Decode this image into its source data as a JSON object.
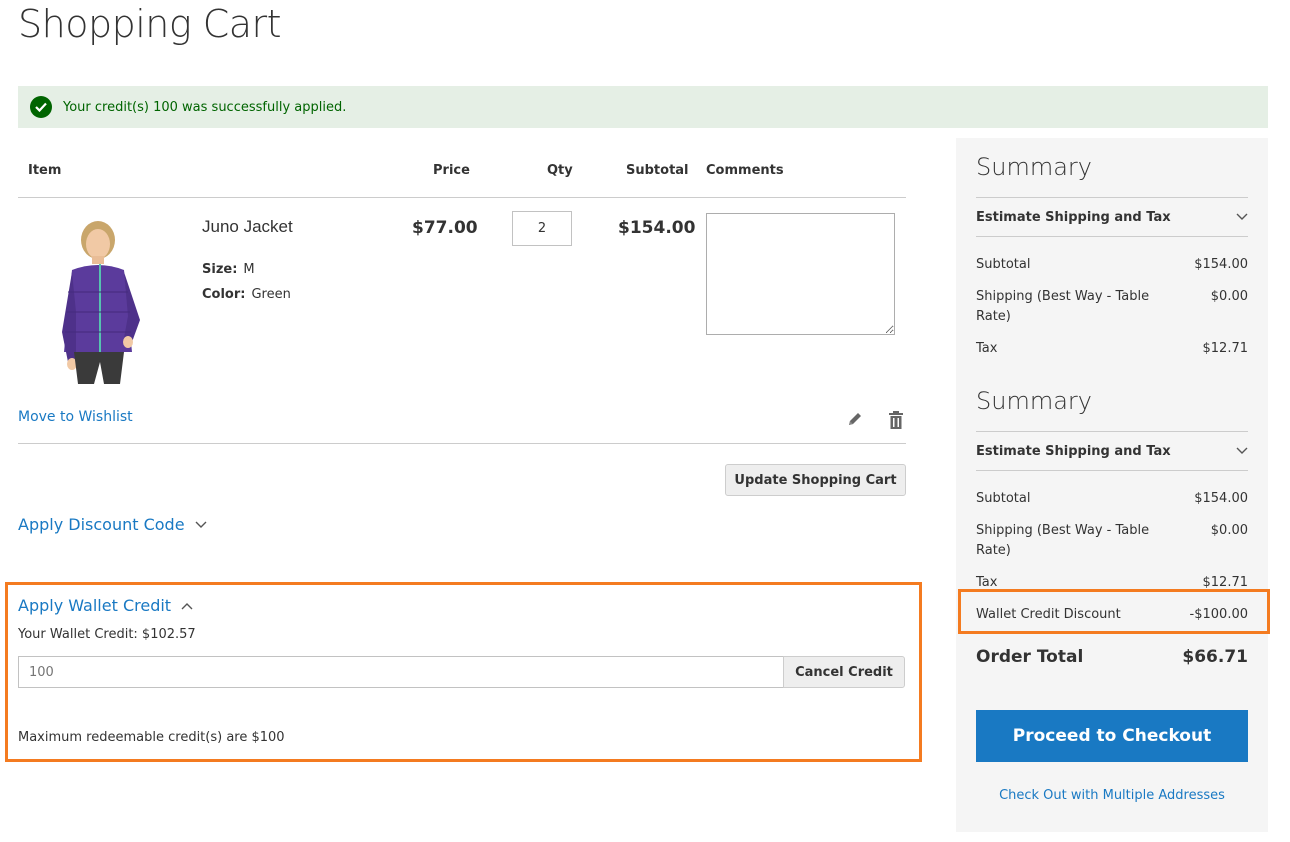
{
  "page": {
    "title": "Shopping Cart"
  },
  "message": {
    "text": "Your credit(s) 100 was successfully applied."
  },
  "cart": {
    "headers": {
      "item": "Item",
      "price": "Price",
      "qty": "Qty",
      "subtotal": "Subtotal",
      "comments": "Comments"
    },
    "item": {
      "name": "Juno Jacket",
      "size_label": "Size:",
      "size_value": "M",
      "color_label": "Color:",
      "color_value": "Green",
      "price": "$77.00",
      "qty": "2",
      "subtotal": "$154.00",
      "comment": ""
    },
    "move_to_wishlist": "Move to Wishlist",
    "update_button": "Update Shopping Cart"
  },
  "discount": {
    "title": "Apply Discount Code"
  },
  "wallet": {
    "title": "Apply Wallet Credit",
    "balance_text": "Your Wallet Credit: $102.57",
    "input_placeholder": "100",
    "cancel_button": "Cancel Credit",
    "max_note": "Maximum redeemable credit(s) are $100"
  },
  "summary": {
    "title": "Summary",
    "estimate_label": "Estimate Shipping and Tax",
    "subtotal_label": "Subtotal",
    "subtotal_value": "$154.00",
    "shipping_label": "Shipping (Best Way - Table Rate)",
    "shipping_value": "$0.00",
    "tax_label": "Tax",
    "tax_value": "$12.71",
    "wallet_discount_label": "Wallet Credit Discount",
    "wallet_discount_value": "-$100.00",
    "order_total_label": "Order Total",
    "order_total_value": "$66.71",
    "checkout_button": "Proceed to Checkout",
    "multi_address_link": "Check Out with Multiple Addresses"
  },
  "colors": {
    "accent": "#1979c3",
    "highlight": "#f47b20",
    "success_bg": "#e5efe5",
    "success_text": "#006400"
  }
}
